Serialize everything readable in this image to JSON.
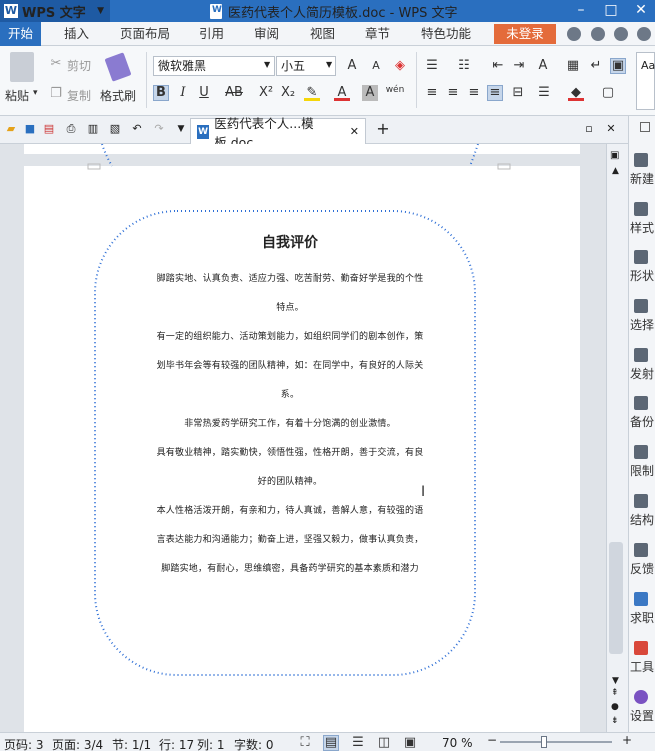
{
  "app": {
    "name": "WPS 文字"
  },
  "window": {
    "title": "医药代表个人简历模板.doc - WPS 文字",
    "minimize": "–",
    "maximize": "□",
    "close": "✕"
  },
  "menu": [
    "开始",
    "插入",
    "页面布局",
    "引用",
    "审阅",
    "视图",
    "章节",
    "特色功能"
  ],
  "login": "未登录",
  "ribbon": {
    "paste": "粘贴",
    "cut": "剪切",
    "copy": "复制",
    "format_painter": "格式刷",
    "font_name": "微软雅黑",
    "font_size": "小五",
    "style_preview": "Aa"
  },
  "doctab": {
    "label": "医药代表个人...模板.doc"
  },
  "document": {
    "heading": "自我评价",
    "lines": [
      "脚踏实地、认真负责、适应力强、吃苦耐劳、勤奋好学是我的个性",
      "特点。",
      "有一定的组织能力、活动策划能力，如组织同学们的剧本创作，策",
      "划毕书年会等有较强的团队精神，如：在同学中，有良好的人际关",
      "系。",
      "非常热爱药学研究工作，有着十分饱满的创业激情。",
      "具有敬业精神，踏实勤快，领悟性强，性格开朗，善于交流，有良",
      "好的团队精神。",
      "本人性格活泼开朗，有亲和力，待人真诚，善解人意，有较强的语",
      "言表达能力和沟通能力；勤奋上进，坚强又毅力，做事认真负责，",
      "脚踏实地，有耐心，思维缜密，具备药学研究的基本素质和潜力"
    ]
  },
  "right_panel": [
    "新建",
    "样式",
    "形状",
    "选择",
    "发射",
    "备份",
    "限制",
    "结构",
    "反馈",
    "求职",
    "工具",
    "设置"
  ],
  "status": {
    "page_code": "页码: 3",
    "page": "页面: 3/4",
    "section": "节: 1/1",
    "row": "行: 17",
    "col": "列: 1",
    "words": "字数: 0",
    "zoom": "70 %"
  },
  "colors": {
    "accent": "#2a6fbf",
    "login": "#e46b3b",
    "border_dots": "#2e6fd6"
  }
}
